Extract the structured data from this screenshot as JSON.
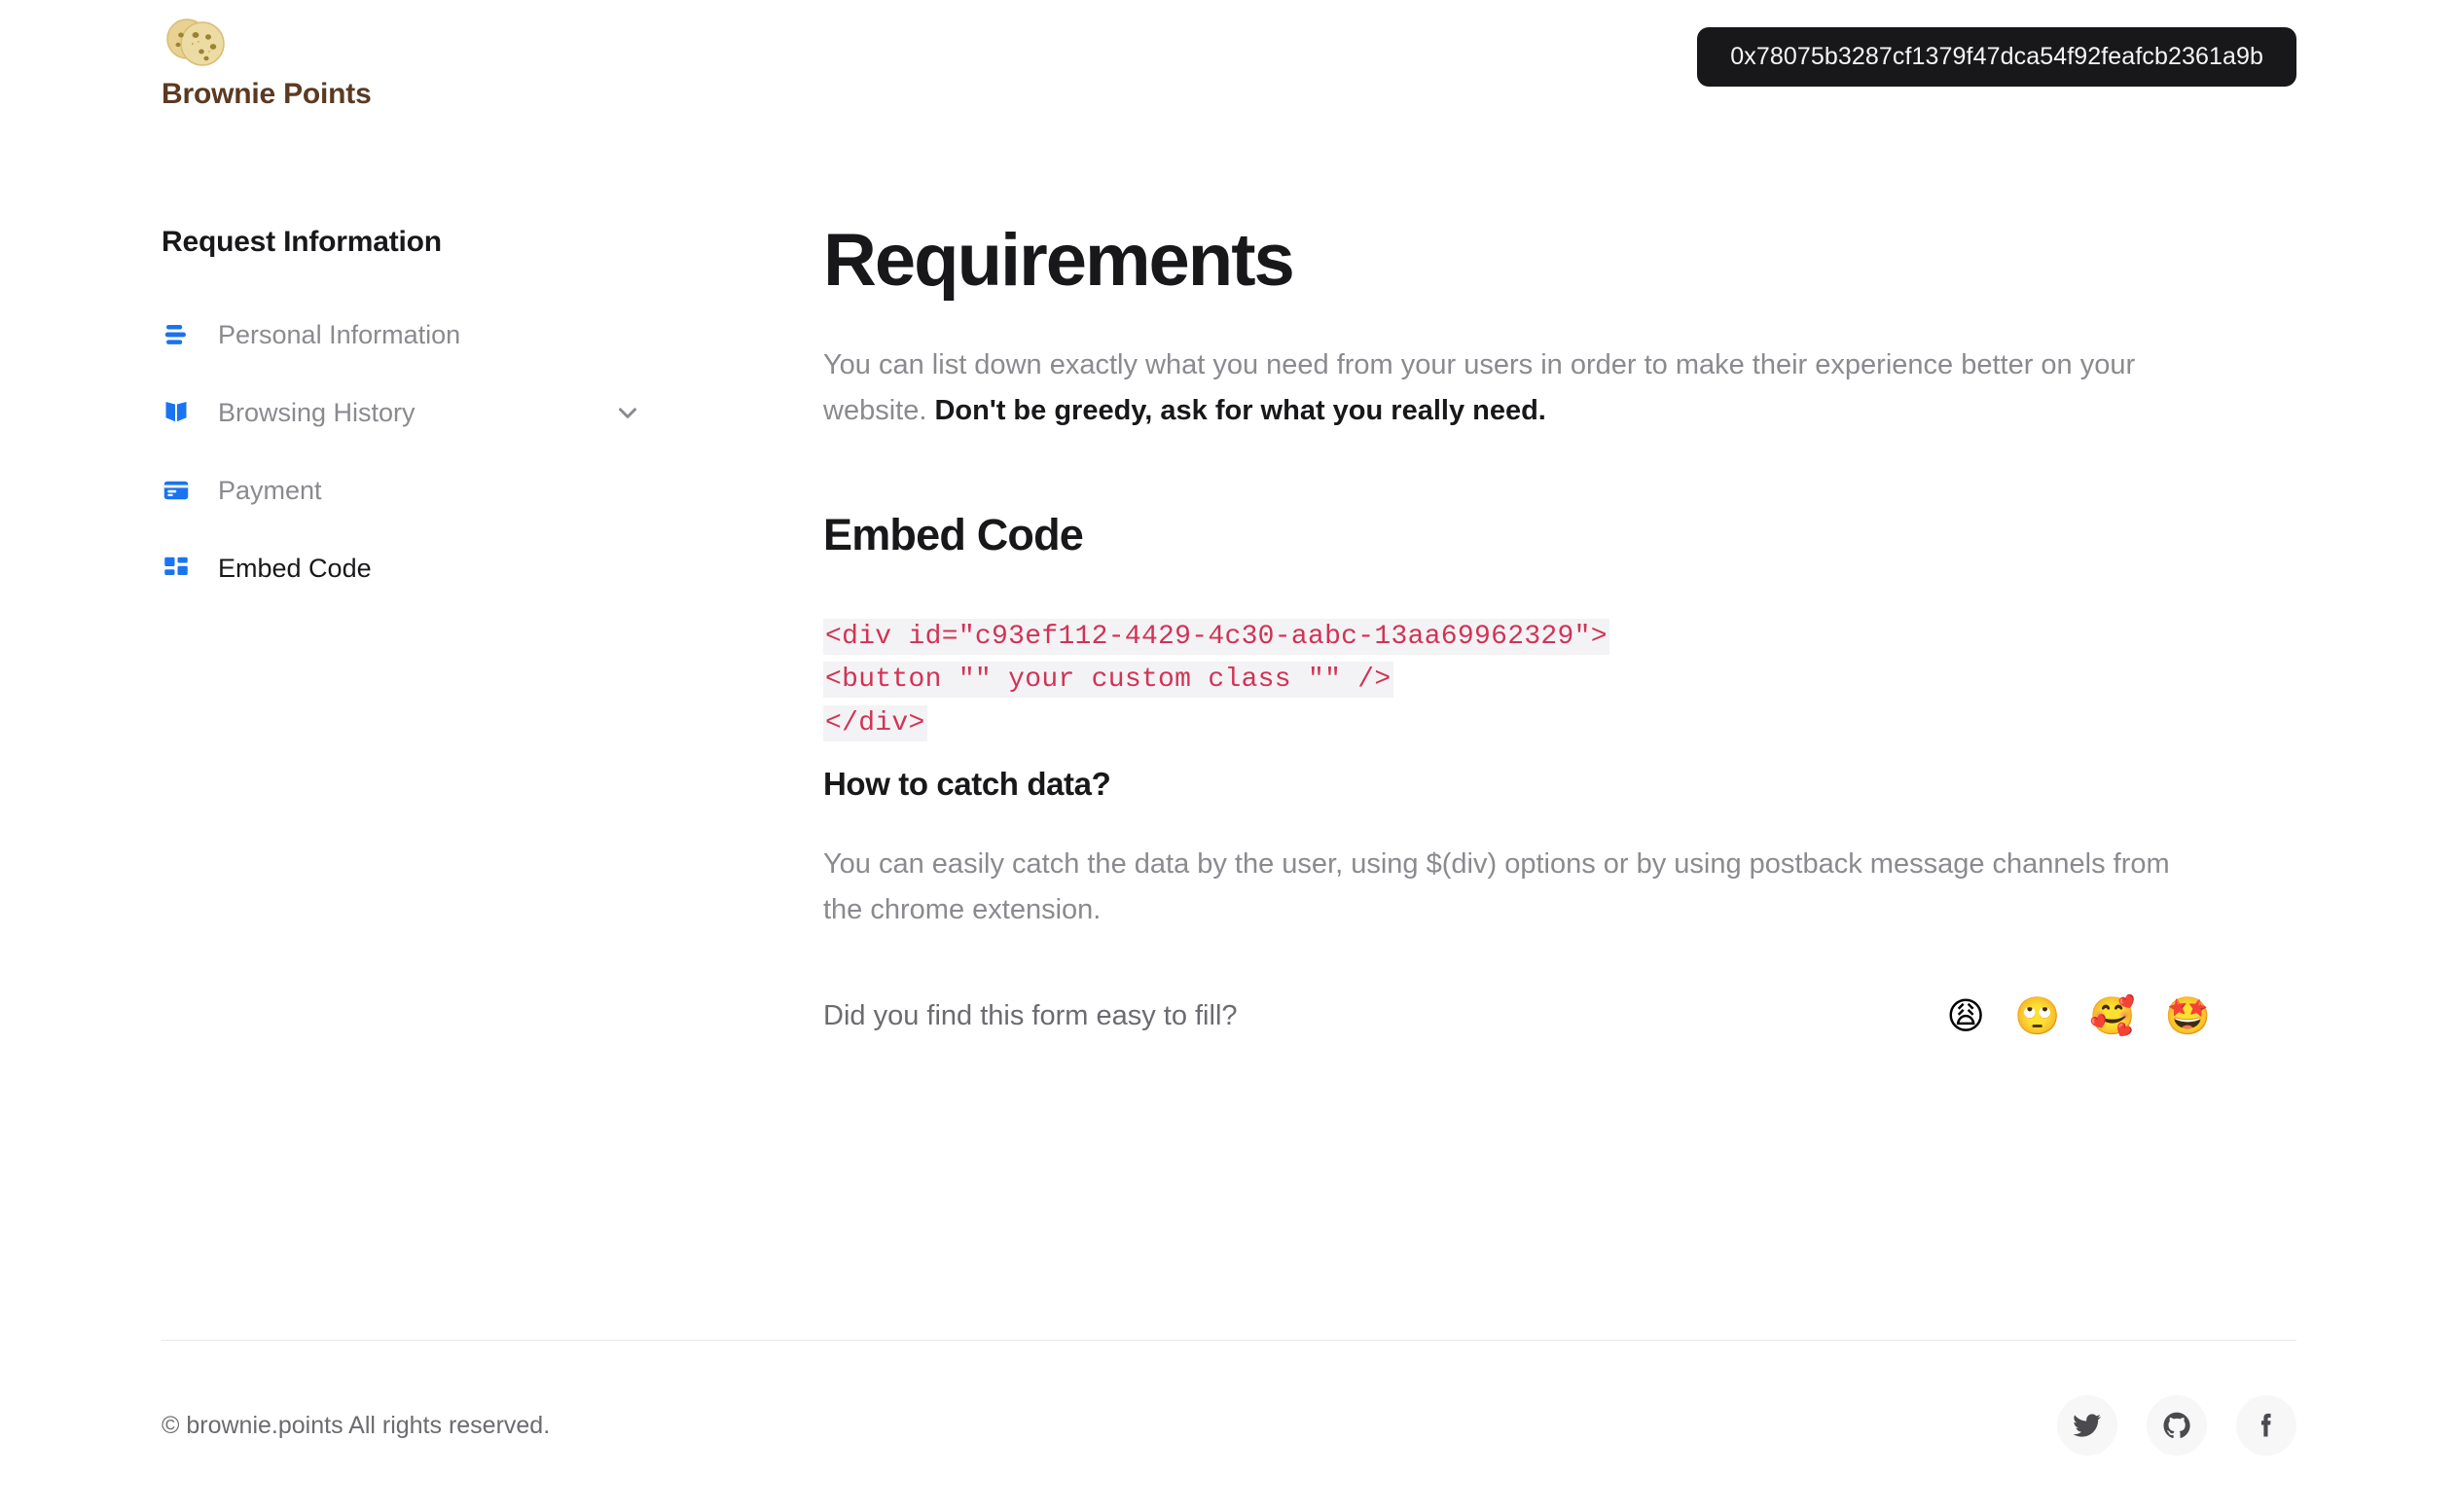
{
  "brand": {
    "icon": "cookie-icon",
    "name": "Brownie Points",
    "color": "#5b3a22"
  },
  "header": {
    "wallet_address": "0x78075b3287cf1379f47dca54f92feafcb2361a9b"
  },
  "sidebar": {
    "title": "Request Information",
    "items": [
      {
        "label": "Personal Information",
        "icon": "text-lines-icon",
        "active": false,
        "expandable": false
      },
      {
        "label": "Browsing History",
        "icon": "open-book-icon",
        "active": false,
        "expandable": true
      },
      {
        "label": "Payment",
        "icon": "credit-card-icon",
        "active": false,
        "expandable": false
      },
      {
        "label": "Embed Code",
        "icon": "dashboard-grid-icon",
        "active": true,
        "expandable": false
      }
    ],
    "chevron_icon": "chevron-down-icon",
    "accent_color": "#1a73f0",
    "inactive_label_color": "#8a8a8f",
    "active_label_color": "#18181b"
  },
  "main": {
    "title": "Requirements",
    "intro_normal": "You can list down exactly what you need from your users in order to make their experience better on your website. ",
    "intro_emphasis": "Don't be greedy, ask for what you really need.",
    "embed_section_title": "Embed Code",
    "code_lines": [
      "<div id=\"c93ef112-4429-4c30-aabc-13aa69962329\">",
      "<button \"\" your custom class \"\" />",
      "</div>"
    ],
    "code_color": "#d13355",
    "code_background": "#f3f3f5",
    "catch_data_title": "How to catch data?",
    "catch_data_text": "You can easily catch the data by the user, using $(div) options or by using postback message channels from the chrome extension.",
    "feedback_question": "Did you find this form easy to fill?",
    "feedback_emojis": [
      {
        "glyph": "😩",
        "name": "weary-face-emoji"
      },
      {
        "glyph": "🙄",
        "name": "rolling-eyes-emoji"
      },
      {
        "glyph": "🥰",
        "name": "smiling-face-with-hearts-emoji"
      },
      {
        "glyph": "🤩",
        "name": "star-struck-emoji"
      }
    ]
  },
  "footer": {
    "copyright": "© brownie.points All rights reserved.",
    "socials": [
      {
        "name": "twitter-icon",
        "label": "Twitter"
      },
      {
        "name": "github-icon",
        "label": "GitHub"
      },
      {
        "name": "facebook-icon",
        "label": "Facebook"
      }
    ]
  }
}
